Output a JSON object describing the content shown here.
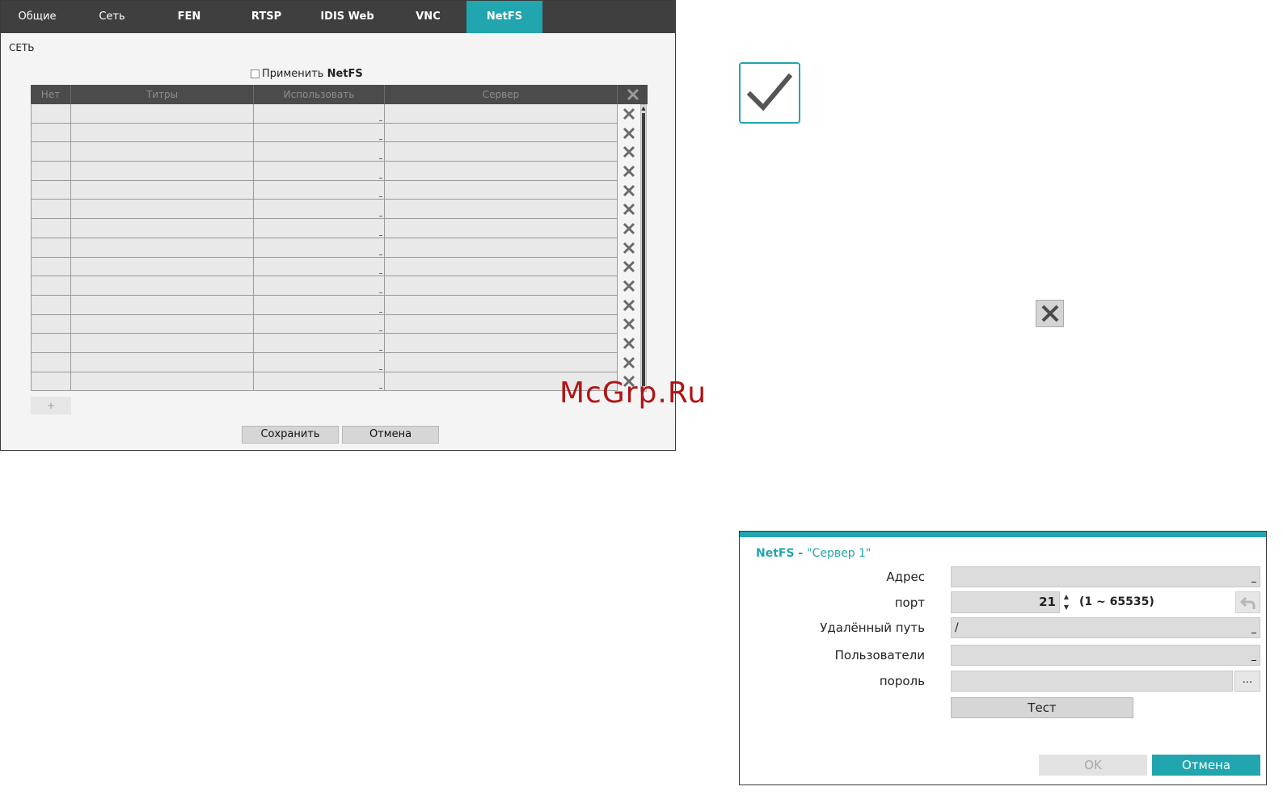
{
  "tabs": [
    {
      "label": "Общие"
    },
    {
      "label": "Сеть"
    },
    {
      "label": "FEN"
    },
    {
      "label": "RTSP"
    },
    {
      "label": "IDIS Web"
    },
    {
      "label": "VNC"
    },
    {
      "label": "NetFS"
    }
  ],
  "active_tab": "NetFS",
  "accent_color": "#21a5ae",
  "section_title": "СЕТЬ",
  "apply": {
    "prefix": "Применить ",
    "bold": "NetFS",
    "checked": false
  },
  "table": {
    "columns": [
      "Нет",
      "Титры",
      "Использовать",
      "Сервер"
    ],
    "row_count": 15,
    "add_label": "+"
  },
  "buttons": {
    "save": "Сохранить",
    "cancel": "Отмена"
  },
  "icons": {
    "check": "check-icon",
    "delete": "close-icon"
  },
  "watermark": "McGrp.Ru",
  "dialog": {
    "title": "NetFS - ",
    "title_server": "\"Сервер 1\"",
    "address_label": "Адрес",
    "address_value": "",
    "port_label": "порт",
    "port_value": "21",
    "port_range": "(1 ~ 65535)",
    "path_label": "Удалённый путь",
    "path_value": "/",
    "users_label": "Пользователи",
    "users_value": "",
    "password_label": "пороль",
    "password_value": "",
    "browse_label": "...",
    "test_label": "Тест",
    "ok_label": "OK",
    "cancel_label": "Отмена"
  }
}
